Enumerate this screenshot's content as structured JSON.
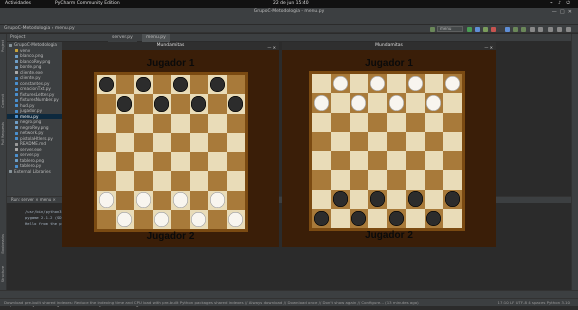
{
  "topbar": {
    "activities": "Actividades",
    "app": "PyCharm Community Edition",
    "clock": "22 de jun  15:40",
    "tray": "⌁ ♪ ⏻"
  },
  "ide": {
    "title": "GrupoC-Metodologia - menu.py",
    "menu": [
      "File",
      "Edit",
      "View",
      "Navigate",
      "Code",
      "Refactor",
      "Run",
      "Tools",
      "Git",
      "Window",
      "Help"
    ],
    "breadcrumb": "GrupoC-Metodologia › menu.py",
    "run_config": "menu",
    "project_label": "Project",
    "editor_tabs": [
      "server.py",
      "menu.py"
    ],
    "tree": [
      {
        "label": "GrupoC-Metodologia",
        "indent": 0,
        "type": "folder"
      },
      {
        "label": "venv",
        "indent": 1,
        "type": "venv"
      },
      {
        "label": "blanco.png",
        "indent": 1,
        "type": "img"
      },
      {
        "label": "blancoRey.png",
        "indent": 1,
        "type": "img"
      },
      {
        "label": "borde.png",
        "indent": 1,
        "type": "img"
      },
      {
        "label": "cliente.exe",
        "indent": 1,
        "type": "file"
      },
      {
        "label": "cliente.py",
        "indent": 1,
        "type": "py"
      },
      {
        "label": "constantes.py",
        "indent": 1,
        "type": "py"
      },
      {
        "label": "creacionTxt.py",
        "indent": 1,
        "type": "py"
      },
      {
        "label": "fixturesLetter.py",
        "indent": 1,
        "type": "py"
      },
      {
        "label": "fixturesNumber.py",
        "indent": 1,
        "type": "py"
      },
      {
        "label": "hud.py",
        "indent": 1,
        "type": "py"
      },
      {
        "label": "jugador.py",
        "indent": 1,
        "type": "py"
      },
      {
        "label": "menu.py",
        "indent": 1,
        "type": "py",
        "selected": true
      },
      {
        "label": "negro.png",
        "indent": 1,
        "type": "img"
      },
      {
        "label": "negroRey.png",
        "indent": 1,
        "type": "img"
      },
      {
        "label": "network.py",
        "indent": 1,
        "type": "py"
      },
      {
        "label": "pistolaHtlers.py",
        "indent": 1,
        "type": "py"
      },
      {
        "label": "README.md",
        "indent": 1,
        "type": "md"
      },
      {
        "label": "server.exe",
        "indent": 1,
        "type": "file"
      },
      {
        "label": "server.py",
        "indent": 1,
        "type": "py"
      },
      {
        "label": "tablero.png",
        "indent": 1,
        "type": "img"
      },
      {
        "label": "tablero.py",
        "indent": 1,
        "type": "py"
      },
      {
        "label": "External Libraries",
        "indent": 0,
        "type": "lib"
      }
    ],
    "run_head": "Run:   server ×   menu ×",
    "console": [
      "/usr/bin/python3 /home/...",
      "pygame 2.1.2 (SDL 2.0.16, Python 3.10.4)",
      "Hello from the pygame community."
    ],
    "bottom_tabs": [
      "▶ Run",
      "Python Packages",
      "☰ TODO",
      "Python Console",
      "● Problems",
      "Terminal",
      "Services"
    ],
    "status_left": "Download pre-built shared indexes: Reduce the indexing time and CPU load with pre-built Python packages shared indexes // Always download // Download once // Don't show again // Configure... (13 minutes ago)",
    "status_right": "17:10   LF   UTF-8   4 spaces   Python 3.10"
  },
  "game_left": {
    "title": "Mundamitas",
    "top_player": "Jugador 1",
    "bottom_player": "Jugador 2",
    "board": [
      "b.b.b.b.",
      ".b.b.b.b",
      "........",
      "........",
      "........",
      "........",
      "w.w.w.w.",
      ".w.w.w.w"
    ]
  },
  "game_right": {
    "title": "Mundamitas",
    "top_player": "Jugador 1",
    "bottom_player": "Jugador 2",
    "board": [
      ".w.w.w.w",
      "w.w.w.w.",
      "........",
      "........",
      "........",
      "........",
      ".b.b.b.b",
      "b.b.b.b."
    ]
  },
  "colors": {
    "board_light": "#e9dcb8",
    "board_dark": "#a87a3a",
    "frame": "#3a1e08"
  }
}
